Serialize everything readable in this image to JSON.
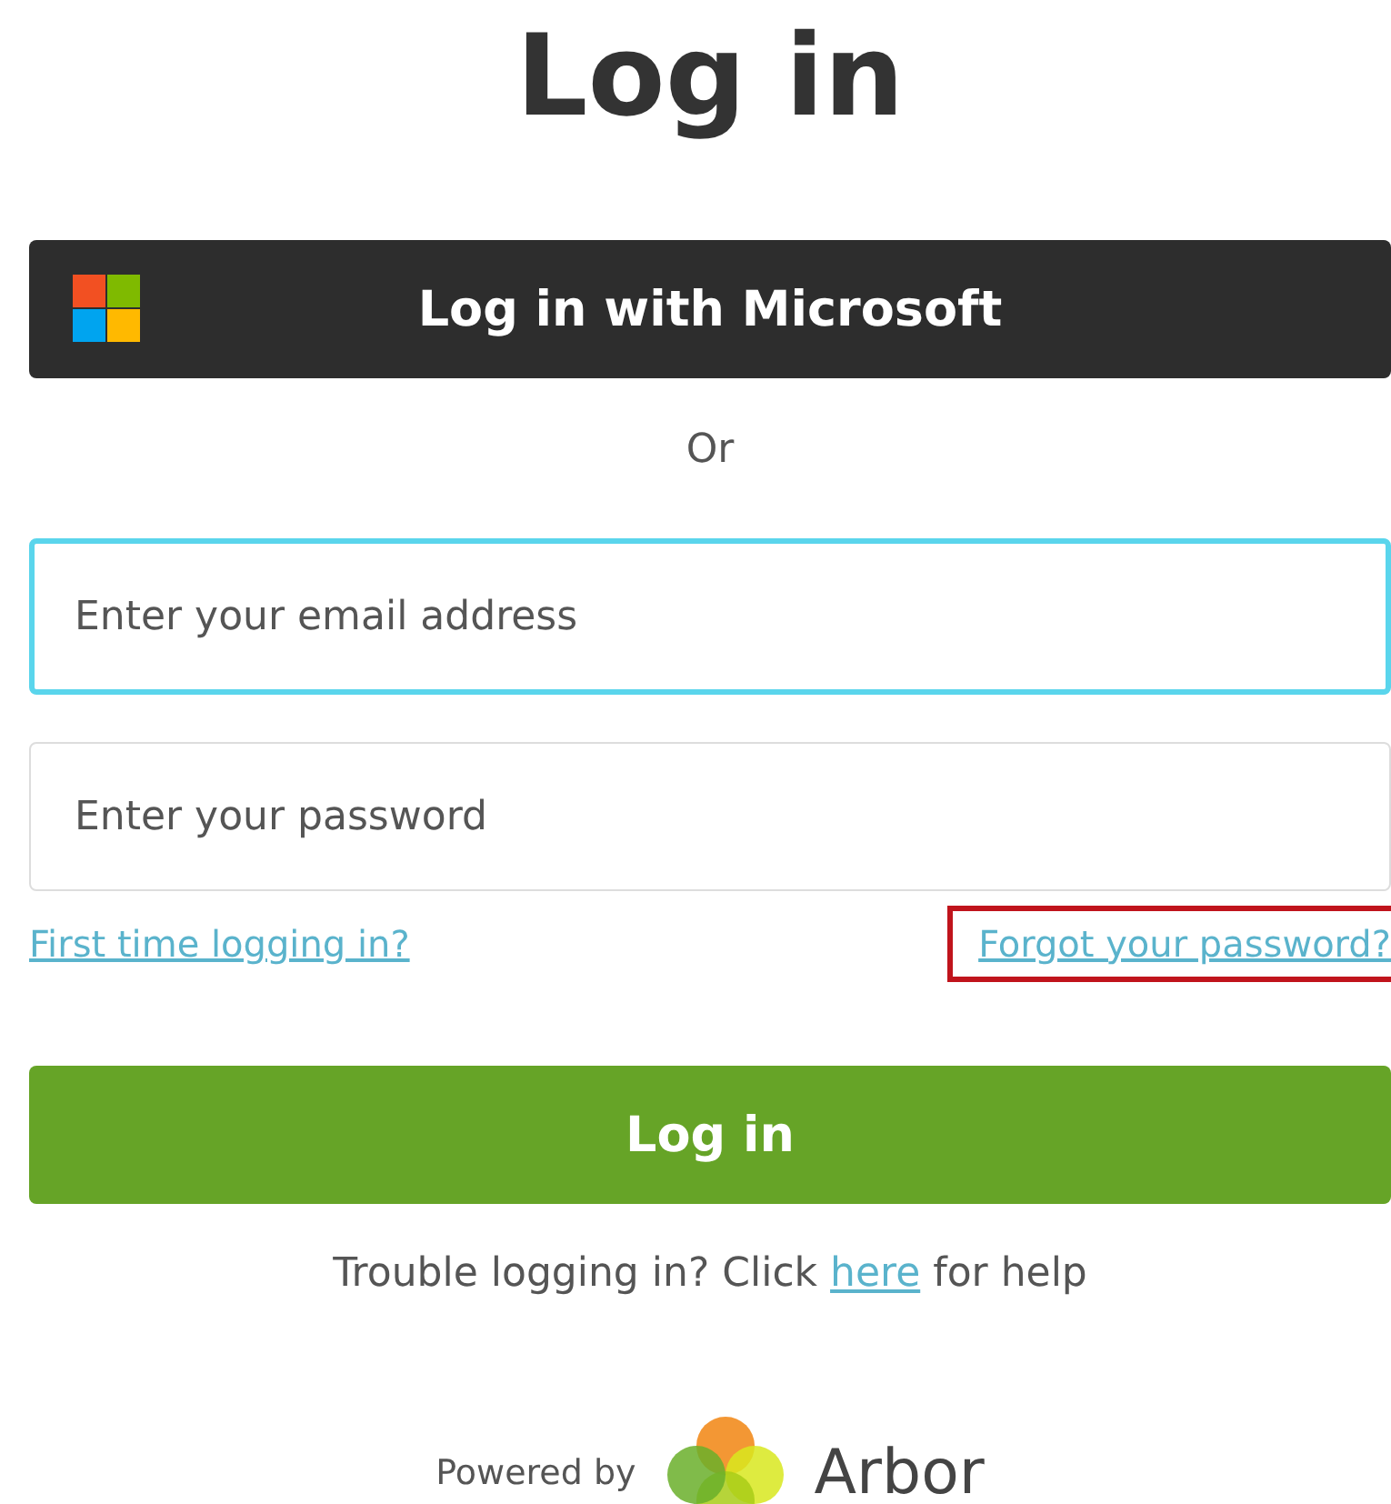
{
  "title": "Log in",
  "microsoft_button": {
    "label": "Log in with Microsoft"
  },
  "divider_text": "Or",
  "fields": [
    {
      "placeholder": "Enter your email address",
      "focused": true
    },
    {
      "placeholder": "Enter your password",
      "focused": false
    }
  ],
  "links": [
    {
      "label": "First time logging in?",
      "highlighted": false
    },
    {
      "label": "Forgot your password?",
      "highlighted": true
    }
  ],
  "login_button": {
    "label": "Log in"
  },
  "help": {
    "before": "Trouble logging in? Click",
    "link": "here",
    "after": "for help"
  },
  "footer": {
    "powered_by": "Powered by",
    "brand": "Arbor"
  }
}
